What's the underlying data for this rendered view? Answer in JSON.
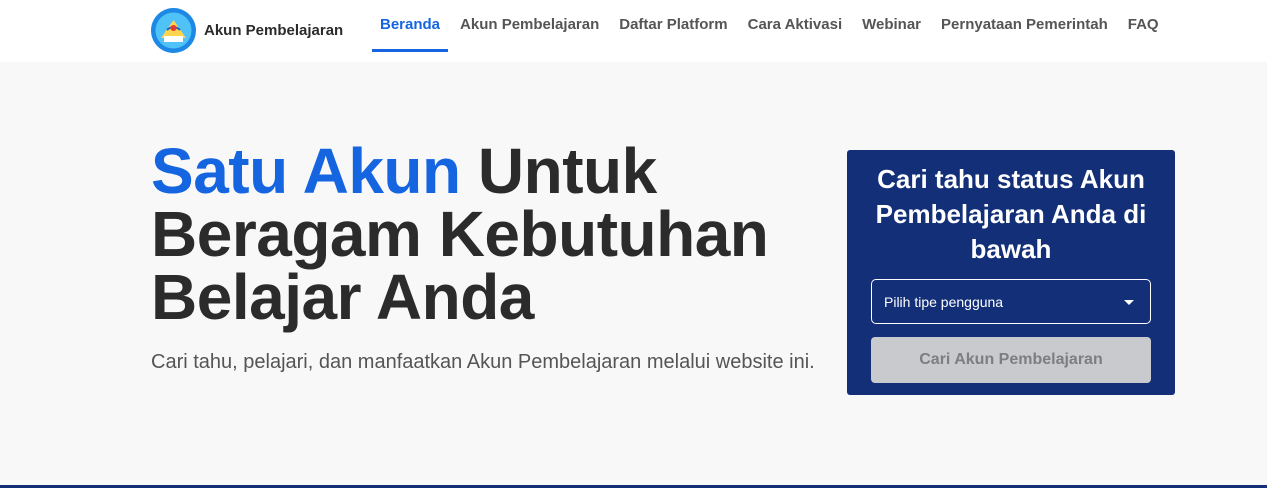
{
  "brand": {
    "name": "Akun Pembelajaran"
  },
  "nav": {
    "items": [
      {
        "label": "Beranda",
        "active": true
      },
      {
        "label": "Akun Pembelajaran",
        "active": false
      },
      {
        "label": "Daftar Platform",
        "active": false
      },
      {
        "label": "Cara Aktivasi",
        "active": false
      },
      {
        "label": "Webinar",
        "active": false
      },
      {
        "label": "Pernyataan Pemerintah",
        "active": false
      },
      {
        "label": "FAQ",
        "active": false
      }
    ]
  },
  "hero": {
    "title_accent": "Satu Akun",
    "title_rest": " Untuk Beragam Kebutuhan Belajar Anda",
    "subtitle": "Cari tahu, pelajari, dan manfaatkan Akun Pembelajaran melalui website ini."
  },
  "search_card": {
    "title": "Cari tahu status Akun Pembelajaran Anda di bawah",
    "select_placeholder": "Pilih tipe pengguna",
    "button_label": "Cari Akun Pembelajaran"
  },
  "colors": {
    "accent": "#1565e0",
    "card_bg": "#122f78",
    "button_disabled": "#c9cacd"
  },
  "icons": [
    "tut-wuri-handayani-logo",
    "caret-down-icon"
  ]
}
